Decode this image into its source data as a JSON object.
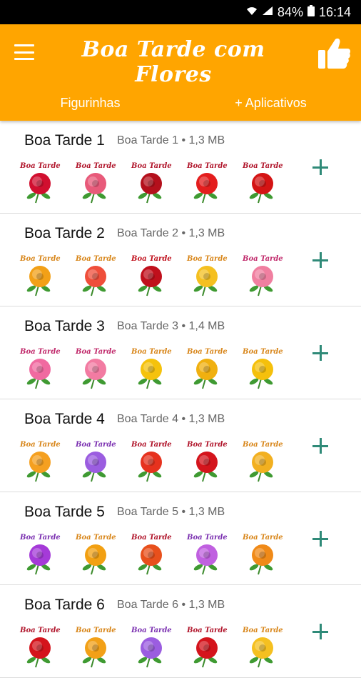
{
  "status": {
    "wifi_icon": "wifi-icon",
    "signal_icon": "signal-icon",
    "battery_text": "84%",
    "battery_icon": "battery-icon",
    "time": "16:14"
  },
  "appbar": {
    "title": "Boa Tarde com Flores",
    "menu_icon": "menu-icon",
    "like_icon": "thumbs-up-icon",
    "accent": "#FFA500"
  },
  "tabs": [
    {
      "label": "Figurinhas"
    },
    {
      "label": "+ Aplicativos"
    }
  ],
  "packs": [
    {
      "name": "Boa Tarde 1",
      "meta": "Boa Tarde 1 • 1,3 MB",
      "stickers": [
        {
          "caption": "Boa Tarde",
          "color": "#d10f2f",
          "cap": "#b0142a"
        },
        {
          "caption": "Boa Tarde",
          "color": "#e85a7a",
          "cap": "#b0142a"
        },
        {
          "caption": "Boa Tarde",
          "color": "#b4101c",
          "cap": "#b0142a"
        },
        {
          "caption": "Boa Tarde",
          "color": "#e41d1d",
          "cap": "#b0142a"
        },
        {
          "caption": "Boa Tarde",
          "color": "#d41414",
          "cap": "#b0142a"
        }
      ]
    },
    {
      "name": "Boa Tarde 2",
      "meta": "Boa Tarde 2 • 1,3 MB",
      "stickers": [
        {
          "caption": "Boa Tarde",
          "color": "#f2a017",
          "cap": "#d8861a"
        },
        {
          "caption": "Boa Tarde",
          "color": "#ef4e3a",
          "cap": "#d8861a"
        },
        {
          "caption": "Boa Tarde",
          "color": "#c0101c",
          "cap": "#c0101c"
        },
        {
          "caption": "Boa Tarde",
          "color": "#f5c020",
          "cap": "#d8861a"
        },
        {
          "caption": "Boa Tarde",
          "color": "#f07fa0",
          "cap": "#c0286a"
        }
      ]
    },
    {
      "name": "Boa Tarde 3",
      "meta": "Boa Tarde 3 • 1,4 MB",
      "stickers": [
        {
          "caption": "Boa Tarde",
          "color": "#f06aa0",
          "cap": "#c0286a"
        },
        {
          "caption": "Boa Tarde",
          "color": "#f27ba2",
          "cap": "#c0286a"
        },
        {
          "caption": "Boa Tarde",
          "color": "#f5c20c",
          "cap": "#d8861a"
        },
        {
          "caption": "Boa Tarde",
          "color": "#f0b010",
          "cap": "#d8861a"
        },
        {
          "caption": "Boa Tarde",
          "color": "#f5c00c",
          "cap": "#d8861a"
        }
      ]
    },
    {
      "name": "Boa Tarde 4",
      "meta": "Boa Tarde 4 • 1,3 MB",
      "stickers": [
        {
          "caption": "Boa Tarde",
          "color": "#f5a020",
          "cap": "#d8861a"
        },
        {
          "caption": "Boa Tarde",
          "color": "#9b5de0",
          "cap": "#7a2fb0"
        },
        {
          "caption": "Boa Tarde",
          "color": "#e6321e",
          "cap": "#b0142a"
        },
        {
          "caption": "Boa Tarde",
          "color": "#d4141c",
          "cap": "#b0142a"
        },
        {
          "caption": "Boa Tarde",
          "color": "#f2b020",
          "cap": "#d8861a"
        }
      ]
    },
    {
      "name": "Boa Tarde 5",
      "meta": "Boa Tarde 5 • 1,3 MB",
      "stickers": [
        {
          "caption": "Boa Tarde",
          "color": "#a53ad8",
          "cap": "#7a2fb0"
        },
        {
          "caption": "Boa Tarde",
          "color": "#f2a012",
          "cap": "#d8861a"
        },
        {
          "caption": "Boa Tarde",
          "color": "#e8501c",
          "cap": "#b0142a"
        },
        {
          "caption": "Boa Tarde",
          "color": "#c060e0",
          "cap": "#7a2fb0"
        },
        {
          "caption": "Boa Tarde",
          "color": "#f08a18",
          "cap": "#d8861a"
        }
      ]
    },
    {
      "name": "Boa Tarde 6",
      "meta": "Boa Tarde 6 • 1,3 MB",
      "stickers": [
        {
          "caption": "Boa Tarde",
          "color": "#d4141c",
          "cap": "#b0142a"
        },
        {
          "caption": "Boa Tarde",
          "color": "#f2a017",
          "cap": "#d8861a"
        },
        {
          "caption": "Boa Tarde",
          "color": "#9b5de0",
          "cap": "#7a2fb0"
        },
        {
          "caption": "Boa Tarde",
          "color": "#d4141c",
          "cap": "#b0142a"
        },
        {
          "caption": "Boa Tarde",
          "color": "#f5c020",
          "cap": "#d8861a"
        }
      ]
    }
  ],
  "add_icon": "plus-icon"
}
